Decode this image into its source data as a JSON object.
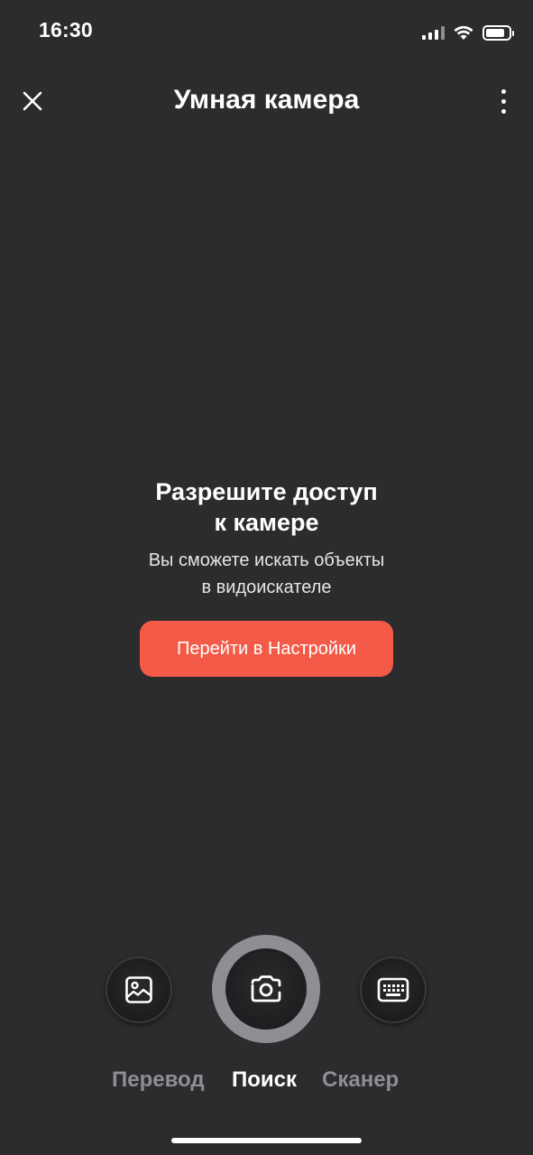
{
  "status_bar": {
    "time": "16:30"
  },
  "header": {
    "title": "Умная камера"
  },
  "permission": {
    "title_line1": "Разрешите доступ",
    "title_line2": "к камере",
    "desc_line1": "Вы сможете искать объекты",
    "desc_line2": "в видоискателе",
    "button_label": "Перейти в Настройки",
    "button_color": "#f35b48"
  },
  "controls": {
    "left_icon": "gallery-icon",
    "center_icon": "camera-icon",
    "right_icon": "keyboard-icon"
  },
  "modes": [
    {
      "label": "Перевод",
      "active": false
    },
    {
      "label": "Поиск",
      "active": true
    },
    {
      "label": "Сканер",
      "active": false
    }
  ]
}
